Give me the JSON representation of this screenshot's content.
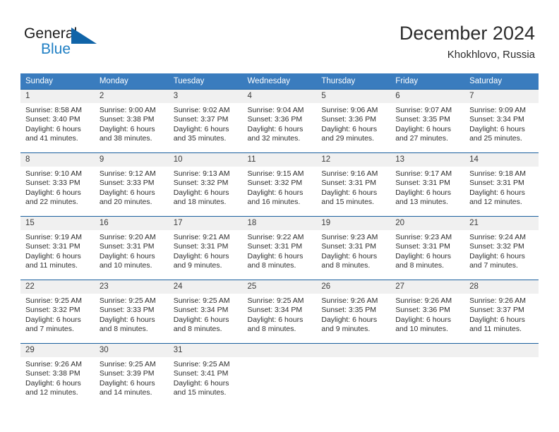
{
  "brand": {
    "name_part1": "General",
    "name_part2": "Blue",
    "logo_icon": "triangle-flag-icon"
  },
  "header": {
    "title": "December 2024",
    "location": "Khokhlovo, Russia"
  },
  "colors": {
    "header_blue": "#3a7cbe",
    "row_border_blue": "#1a5f9e",
    "date_bar_gray": "#f0f0f0",
    "brand_blue": "#1f7fc4",
    "logo_blue": "#1064a8"
  },
  "weekdays": [
    "Sunday",
    "Monday",
    "Tuesday",
    "Wednesday",
    "Thursday",
    "Friday",
    "Saturday"
  ],
  "weeks": [
    [
      {
        "day": "1",
        "sunrise": "Sunrise: 8:58 AM",
        "sunset": "Sunset: 3:40 PM",
        "daylight_line1": "Daylight: 6 hours",
        "daylight_line2": "and 41 minutes."
      },
      {
        "day": "2",
        "sunrise": "Sunrise: 9:00 AM",
        "sunset": "Sunset: 3:38 PM",
        "daylight_line1": "Daylight: 6 hours",
        "daylight_line2": "and 38 minutes."
      },
      {
        "day": "3",
        "sunrise": "Sunrise: 9:02 AM",
        "sunset": "Sunset: 3:37 PM",
        "daylight_line1": "Daylight: 6 hours",
        "daylight_line2": "and 35 minutes."
      },
      {
        "day": "4",
        "sunrise": "Sunrise: 9:04 AM",
        "sunset": "Sunset: 3:36 PM",
        "daylight_line1": "Daylight: 6 hours",
        "daylight_line2": "and 32 minutes."
      },
      {
        "day": "5",
        "sunrise": "Sunrise: 9:06 AM",
        "sunset": "Sunset: 3:36 PM",
        "daylight_line1": "Daylight: 6 hours",
        "daylight_line2": "and 29 minutes."
      },
      {
        "day": "6",
        "sunrise": "Sunrise: 9:07 AM",
        "sunset": "Sunset: 3:35 PM",
        "daylight_line1": "Daylight: 6 hours",
        "daylight_line2": "and 27 minutes."
      },
      {
        "day": "7",
        "sunrise": "Sunrise: 9:09 AM",
        "sunset": "Sunset: 3:34 PM",
        "daylight_line1": "Daylight: 6 hours",
        "daylight_line2": "and 25 minutes."
      }
    ],
    [
      {
        "day": "8",
        "sunrise": "Sunrise: 9:10 AM",
        "sunset": "Sunset: 3:33 PM",
        "daylight_line1": "Daylight: 6 hours",
        "daylight_line2": "and 22 minutes."
      },
      {
        "day": "9",
        "sunrise": "Sunrise: 9:12 AM",
        "sunset": "Sunset: 3:33 PM",
        "daylight_line1": "Daylight: 6 hours",
        "daylight_line2": "and 20 minutes."
      },
      {
        "day": "10",
        "sunrise": "Sunrise: 9:13 AM",
        "sunset": "Sunset: 3:32 PM",
        "daylight_line1": "Daylight: 6 hours",
        "daylight_line2": "and 18 minutes."
      },
      {
        "day": "11",
        "sunrise": "Sunrise: 9:15 AM",
        "sunset": "Sunset: 3:32 PM",
        "daylight_line1": "Daylight: 6 hours",
        "daylight_line2": "and 16 minutes."
      },
      {
        "day": "12",
        "sunrise": "Sunrise: 9:16 AM",
        "sunset": "Sunset: 3:31 PM",
        "daylight_line1": "Daylight: 6 hours",
        "daylight_line2": "and 15 minutes."
      },
      {
        "day": "13",
        "sunrise": "Sunrise: 9:17 AM",
        "sunset": "Sunset: 3:31 PM",
        "daylight_line1": "Daylight: 6 hours",
        "daylight_line2": "and 13 minutes."
      },
      {
        "day": "14",
        "sunrise": "Sunrise: 9:18 AM",
        "sunset": "Sunset: 3:31 PM",
        "daylight_line1": "Daylight: 6 hours",
        "daylight_line2": "and 12 minutes."
      }
    ],
    [
      {
        "day": "15",
        "sunrise": "Sunrise: 9:19 AM",
        "sunset": "Sunset: 3:31 PM",
        "daylight_line1": "Daylight: 6 hours",
        "daylight_line2": "and 11 minutes."
      },
      {
        "day": "16",
        "sunrise": "Sunrise: 9:20 AM",
        "sunset": "Sunset: 3:31 PM",
        "daylight_line1": "Daylight: 6 hours",
        "daylight_line2": "and 10 minutes."
      },
      {
        "day": "17",
        "sunrise": "Sunrise: 9:21 AM",
        "sunset": "Sunset: 3:31 PM",
        "daylight_line1": "Daylight: 6 hours",
        "daylight_line2": "and 9 minutes."
      },
      {
        "day": "18",
        "sunrise": "Sunrise: 9:22 AM",
        "sunset": "Sunset: 3:31 PM",
        "daylight_line1": "Daylight: 6 hours",
        "daylight_line2": "and 8 minutes."
      },
      {
        "day": "19",
        "sunrise": "Sunrise: 9:23 AM",
        "sunset": "Sunset: 3:31 PM",
        "daylight_line1": "Daylight: 6 hours",
        "daylight_line2": "and 8 minutes."
      },
      {
        "day": "20",
        "sunrise": "Sunrise: 9:23 AM",
        "sunset": "Sunset: 3:31 PM",
        "daylight_line1": "Daylight: 6 hours",
        "daylight_line2": "and 8 minutes."
      },
      {
        "day": "21",
        "sunrise": "Sunrise: 9:24 AM",
        "sunset": "Sunset: 3:32 PM",
        "daylight_line1": "Daylight: 6 hours",
        "daylight_line2": "and 7 minutes."
      }
    ],
    [
      {
        "day": "22",
        "sunrise": "Sunrise: 9:25 AM",
        "sunset": "Sunset: 3:32 PM",
        "daylight_line1": "Daylight: 6 hours",
        "daylight_line2": "and 7 minutes."
      },
      {
        "day": "23",
        "sunrise": "Sunrise: 9:25 AM",
        "sunset": "Sunset: 3:33 PM",
        "daylight_line1": "Daylight: 6 hours",
        "daylight_line2": "and 8 minutes."
      },
      {
        "day": "24",
        "sunrise": "Sunrise: 9:25 AM",
        "sunset": "Sunset: 3:34 PM",
        "daylight_line1": "Daylight: 6 hours",
        "daylight_line2": "and 8 minutes."
      },
      {
        "day": "25",
        "sunrise": "Sunrise: 9:25 AM",
        "sunset": "Sunset: 3:34 PM",
        "daylight_line1": "Daylight: 6 hours",
        "daylight_line2": "and 8 minutes."
      },
      {
        "day": "26",
        "sunrise": "Sunrise: 9:26 AM",
        "sunset": "Sunset: 3:35 PM",
        "daylight_line1": "Daylight: 6 hours",
        "daylight_line2": "and 9 minutes."
      },
      {
        "day": "27",
        "sunrise": "Sunrise: 9:26 AM",
        "sunset": "Sunset: 3:36 PM",
        "daylight_line1": "Daylight: 6 hours",
        "daylight_line2": "and 10 minutes."
      },
      {
        "day": "28",
        "sunrise": "Sunrise: 9:26 AM",
        "sunset": "Sunset: 3:37 PM",
        "daylight_line1": "Daylight: 6 hours",
        "daylight_line2": "and 11 minutes."
      }
    ],
    [
      {
        "day": "29",
        "sunrise": "Sunrise: 9:26 AM",
        "sunset": "Sunset: 3:38 PM",
        "daylight_line1": "Daylight: 6 hours",
        "daylight_line2": "and 12 minutes."
      },
      {
        "day": "30",
        "sunrise": "Sunrise: 9:25 AM",
        "sunset": "Sunset: 3:39 PM",
        "daylight_line1": "Daylight: 6 hours",
        "daylight_line2": "and 14 minutes."
      },
      {
        "day": "31",
        "sunrise": "Sunrise: 9:25 AM",
        "sunset": "Sunset: 3:41 PM",
        "daylight_line1": "Daylight: 6 hours",
        "daylight_line2": "and 15 minutes."
      },
      {
        "day": "",
        "sunrise": "",
        "sunset": "",
        "daylight_line1": "",
        "daylight_line2": ""
      },
      {
        "day": "",
        "sunrise": "",
        "sunset": "",
        "daylight_line1": "",
        "daylight_line2": ""
      },
      {
        "day": "",
        "sunrise": "",
        "sunset": "",
        "daylight_line1": "",
        "daylight_line2": ""
      },
      {
        "day": "",
        "sunrise": "",
        "sunset": "",
        "daylight_line1": "",
        "daylight_line2": ""
      }
    ]
  ]
}
